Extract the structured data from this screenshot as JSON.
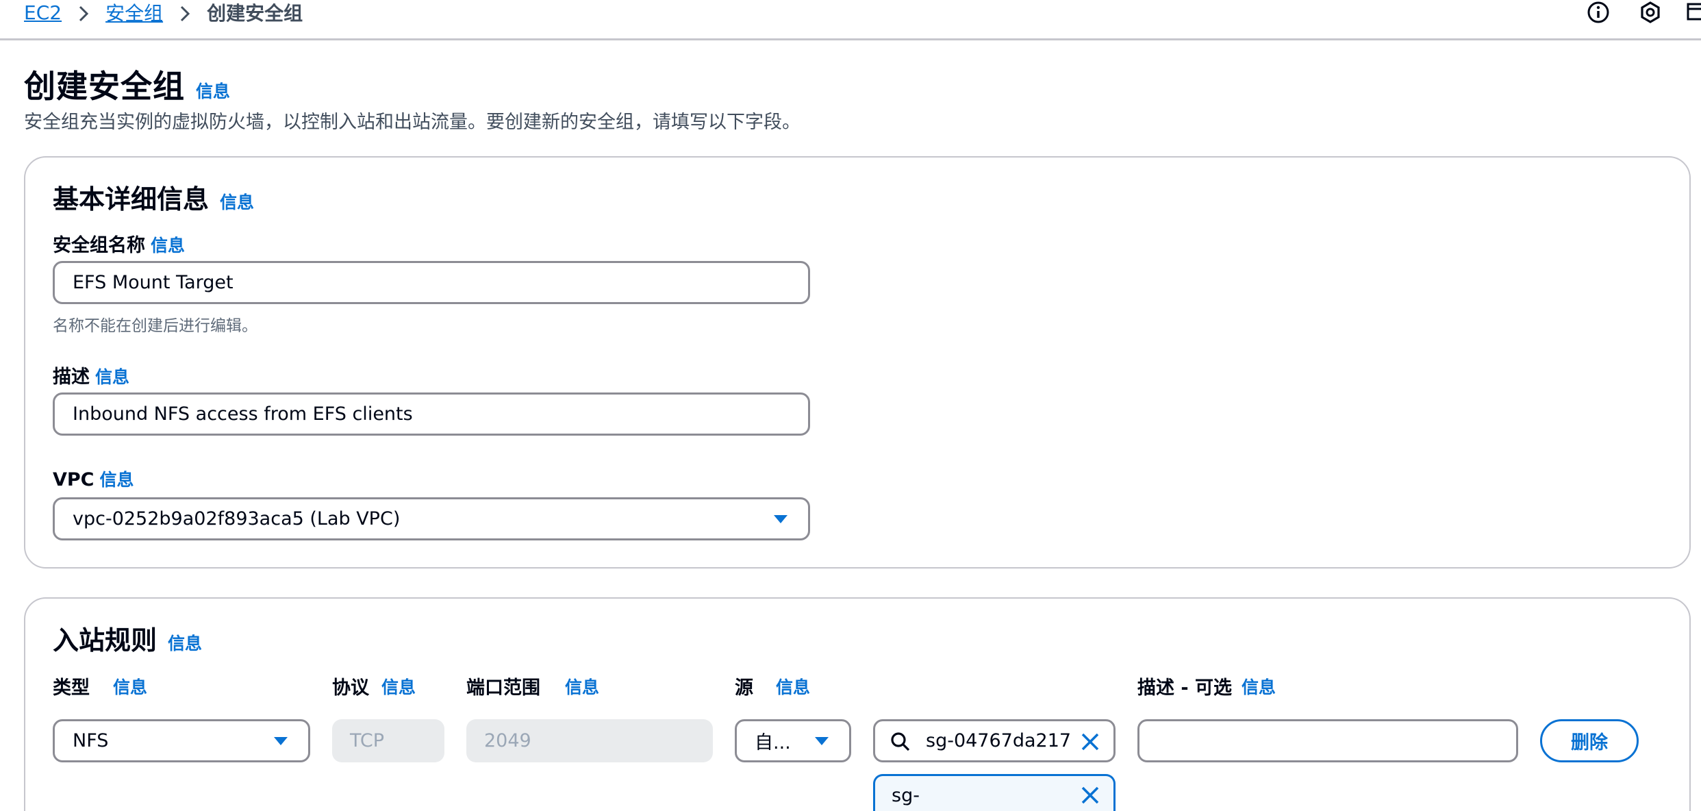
{
  "breadcrumb": {
    "items": [
      {
        "label": "EC2"
      },
      {
        "label": "安全组"
      }
    ],
    "current": "创建安全组"
  },
  "top_icons": [
    "info-circle-icon",
    "settings-hexagon-icon",
    "external-panel-icon"
  ],
  "header": {
    "title": "创建安全组",
    "info": "信息",
    "description": "安全组充当实例的虚拟防火墙，以控制入站和出站流量。要创建新的安全组，请填写以下字段。"
  },
  "basic": {
    "title": "基本详细信息",
    "info": "信息",
    "name_label": "安全组名称",
    "name_info": "信息",
    "name_value": "EFS Mount Target",
    "name_hint": "名称不能在创建后进行编辑。",
    "desc_label": "描述",
    "desc_info": "信息",
    "desc_value": "Inbound NFS access from EFS clients",
    "vpc_label": "VPC",
    "vpc_info": "信息",
    "vpc_value": "vpc-0252b9a02f893aca5 (Lab VPC)"
  },
  "inbound": {
    "title": "入站规则",
    "info": "信息",
    "columns": {
      "type": "类型",
      "type_info": "信息",
      "protocol": "协议",
      "protocol_info": "信息",
      "port": "端口范围",
      "port_info": "信息",
      "source": "源",
      "source_info": "信息",
      "description": "描述 - 可选",
      "description_info": "信息"
    },
    "rule": {
      "type": "NFS",
      "protocol": "TCP",
      "port": "2049",
      "source_type": "自...",
      "source_search": "sg-04767da217",
      "description": "",
      "delete_label": "删除",
      "token": "sg-"
    }
  },
  "colors": {
    "link": "#0972d3",
    "border": "#8c8c94",
    "disabled_bg": "#e9ebed"
  }
}
